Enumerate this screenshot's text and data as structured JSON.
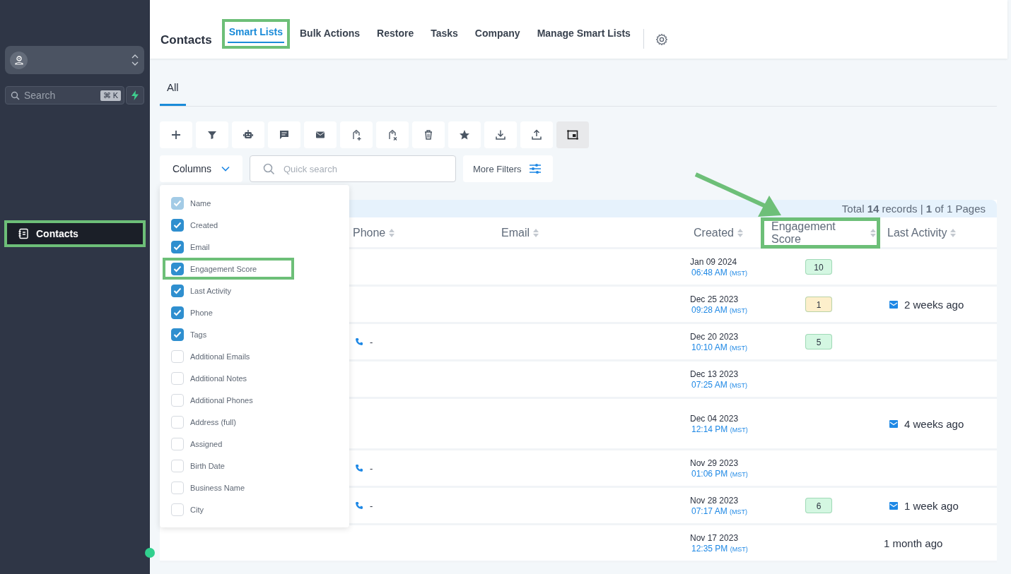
{
  "sidebar": {
    "search": {
      "placeholder": "Search",
      "shortcut": "⌘ K"
    },
    "nav": [
      {
        "label": "Contacts",
        "selected": true,
        "highlighted": true
      }
    ]
  },
  "header": {
    "title": "Contacts",
    "tabs": [
      {
        "label": "Smart Lists",
        "selected": true,
        "highlighted": true
      },
      {
        "label": "Bulk Actions",
        "selected": false,
        "highlighted": false
      },
      {
        "label": "Restore",
        "selected": false,
        "highlighted": false
      },
      {
        "label": "Tasks",
        "selected": false,
        "highlighted": false
      },
      {
        "label": "Company",
        "selected": false,
        "highlighted": false
      },
      {
        "label": "Manage Smart Lists",
        "selected": false,
        "highlighted": false
      }
    ]
  },
  "sub_tabs": [
    {
      "label": "All",
      "selected": true
    }
  ],
  "toolbar": [
    {
      "kind": "add",
      "selected": false
    },
    {
      "kind": "filter",
      "selected": false
    },
    {
      "kind": "robot",
      "selected": false
    },
    {
      "kind": "chat",
      "selected": false
    },
    {
      "kind": "mail",
      "selected": false
    },
    {
      "kind": "tag-add",
      "selected": false
    },
    {
      "kind": "tag-remove",
      "selected": false
    },
    {
      "kind": "trash",
      "selected": false
    },
    {
      "kind": "star",
      "selected": false
    },
    {
      "kind": "download",
      "selected": false
    },
    {
      "kind": "upload",
      "selected": false
    },
    {
      "kind": "columns",
      "selected": true
    }
  ],
  "filters": {
    "columns_button": "Columns",
    "quick_search": {
      "placeholder": "Quick search"
    },
    "more_filters": "More Filters"
  },
  "columns_menu": [
    {
      "label": "Name",
      "checked": true,
      "disabled": true,
      "highlighted": false
    },
    {
      "label": "Created",
      "checked": true,
      "disabled": false,
      "highlighted": false
    },
    {
      "label": "Email",
      "checked": true,
      "disabled": false,
      "highlighted": false
    },
    {
      "label": "Engagement Score",
      "checked": true,
      "disabled": false,
      "highlighted": true
    },
    {
      "label": "Last Activity",
      "checked": true,
      "disabled": false,
      "highlighted": false
    },
    {
      "label": "Phone",
      "checked": true,
      "disabled": false,
      "highlighted": false
    },
    {
      "label": "Tags",
      "checked": true,
      "disabled": false,
      "highlighted": false
    },
    {
      "label": "Additional Emails",
      "checked": false,
      "disabled": false,
      "highlighted": false
    },
    {
      "label": "Additional Notes",
      "checked": false,
      "disabled": false,
      "highlighted": false
    },
    {
      "label": "Additional Phones",
      "checked": false,
      "disabled": false,
      "highlighted": false
    },
    {
      "label": "Address (full)",
      "checked": false,
      "disabled": false,
      "highlighted": false
    },
    {
      "label": "Assigned",
      "checked": false,
      "disabled": false,
      "highlighted": false
    },
    {
      "label": "Birth Date",
      "checked": false,
      "disabled": false,
      "highlighted": false
    },
    {
      "label": "Business Name",
      "checked": false,
      "disabled": false,
      "highlighted": false
    },
    {
      "label": "City",
      "checked": false,
      "disabled": false,
      "highlighted": false
    }
  ],
  "table": {
    "summary": "Total **14** records | **1** of 1 Pages",
    "columns": [
      {
        "label": "Phone",
        "highlighted": false
      },
      {
        "label": "Email",
        "highlighted": false
      },
      {
        "label": "Created",
        "highlighted": false
      },
      {
        "label": "Engagement Score",
        "highlighted": true
      },
      {
        "label": "Last Activity",
        "highlighted": false
      }
    ],
    "rows": [
      {
        "date": "Jan 09 2024",
        "time": "06:48 AM",
        "tz": "(MST)",
        "score": {
          "text": "10",
          "color": "#d4f7e2"
        }
      },
      {
        "date": "Dec 25 2023",
        "time": "09:28 AM",
        "tz": "(MST)",
        "score": {
          "text": "1",
          "color": "#fdefcb"
        },
        "activity": {
          "text": "2 weeks ago",
          "kind": "email"
        }
      },
      {
        "date": "Dec 20 2023",
        "time": "10:10 AM",
        "tz": "(MST)",
        "phone": "-",
        "score": {
          "text": "5",
          "color": "#d4f7e2"
        }
      },
      {
        "date": "Dec 13 2023",
        "time": "07:25 AM",
        "tz": "(MST)"
      },
      {
        "date": "Dec 04 2023",
        "time": "12:14 PM",
        "tz": "(MST)",
        "activity": {
          "text": "4 weeks ago",
          "kind": "email"
        }
      },
      {
        "date": "Nov 29 2023",
        "time": "01:06 PM",
        "tz": "(MST)",
        "phone": "-"
      },
      {
        "date": "Nov 28 2023",
        "time": "07:17 AM",
        "tz": "(MST)",
        "phone": "-",
        "score": {
          "text": "6",
          "color": "#d4f7e2"
        },
        "activity": {
          "text": "1 week ago",
          "kind": "email"
        }
      },
      {
        "date": "Nov 17 2023",
        "time": "12:35 PM",
        "tz": "(MST)",
        "activity": {
          "text": "1 month ago",
          "kind": "none"
        }
      }
    ]
  }
}
